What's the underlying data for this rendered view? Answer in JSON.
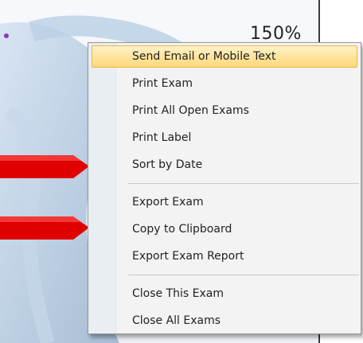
{
  "viewer": {
    "zoom_label": "150%"
  },
  "context_menu": {
    "items": [
      {
        "label": "Send Email or Mobile Text",
        "highlighted": true
      },
      {
        "label": "Print Exam"
      },
      {
        "label": "Print All Open Exams"
      },
      {
        "label": "Print Label"
      },
      {
        "label": "Sort by Date"
      },
      {
        "label": "Export Exam"
      },
      {
        "label": "Copy to Clipboard"
      },
      {
        "label": "Export Exam Report"
      },
      {
        "label": "Close This Exam"
      },
      {
        "label": "Close All Exams"
      }
    ]
  },
  "colors": {
    "highlight_top": "#fff2c8",
    "highlight_bottom": "#ffd878",
    "arrow_red": "#e00000"
  }
}
